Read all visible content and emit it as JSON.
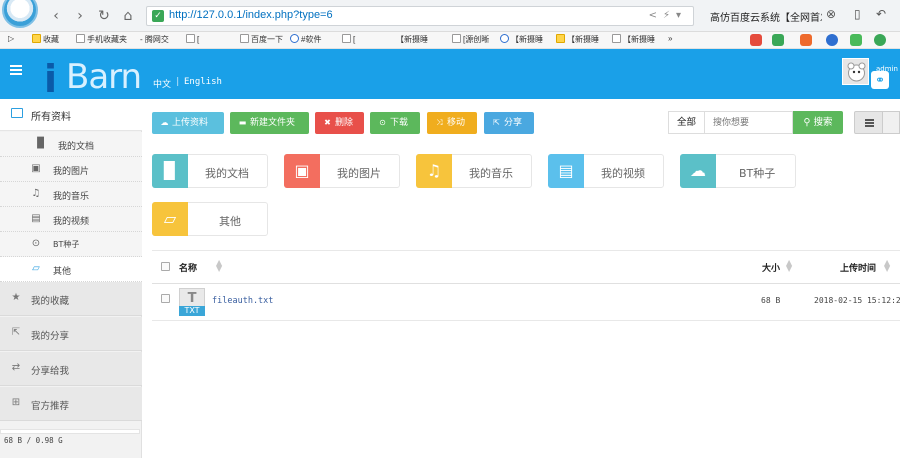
{
  "browser": {
    "url": "http://127.0.0.1/index.php?type=6",
    "tab_title": "高仿百度云系统【全网首发",
    "bookmarks": [
      "收藏",
      "手机收藏夹",
      "- 腾网交",
      "[",
      "百度一下",
      "#软件",
      "[",
      "【新摄睡",
      "[源创晰",
      "【新摄睡",
      "【新摄睡",
      "【新摄睡",
      "»"
    ]
  },
  "header": {
    "logo_i": "i",
    "logo_rest": "Barn",
    "lang_zh": "中文",
    "lang_sep": "|",
    "lang_en": "English",
    "user_name": "admin"
  },
  "sidebar": {
    "all_files": "所有资料",
    "sub_items": [
      {
        "label": "我的文档",
        "icon": "document-icon"
      },
      {
        "label": "我的图片",
        "icon": "image-icon"
      },
      {
        "label": "我的音乐",
        "icon": "music-icon"
      },
      {
        "label": "我的视频",
        "icon": "film-icon"
      },
      {
        "label": "BT种子",
        "icon": "download-circle-icon"
      },
      {
        "label": "其他",
        "icon": "folder-open-icon"
      }
    ],
    "items": [
      {
        "label": "我的收藏",
        "icon": "star-icon"
      },
      {
        "label": "我的分享",
        "icon": "share-icon"
      },
      {
        "label": "分享给我",
        "icon": "retweet-icon"
      },
      {
        "label": "官方推荐",
        "icon": "gift-icon"
      }
    ],
    "quota": "68 B / 0.98 G"
  },
  "toolbar": {
    "upload": "上传资料",
    "new_folder": "新建文件夹",
    "delete": "删除",
    "download": "下载",
    "move": "移动",
    "share": "分享",
    "search_scope": "全部",
    "search_placeholder": "搜你想要",
    "search_button": "搜索"
  },
  "categories": [
    {
      "label": "我的文档",
      "color": "#5bc0c8"
    },
    {
      "label": "我的图片",
      "color": "#f36e5f"
    },
    {
      "label": "我的音乐",
      "color": "#f7c43c"
    },
    {
      "label": "我的视频",
      "color": "#5bc0ec"
    },
    {
      "label": "BT种子",
      "color": "#5bc0c8"
    },
    {
      "label": "其他",
      "color": "#f7c43c"
    }
  ],
  "table": {
    "col_name": "名称",
    "col_size": "大小",
    "col_time": "上传时间",
    "rows": [
      {
        "icon_letter": "T",
        "icon_tag": "TXT",
        "name": "fileauth.txt",
        "size": "68 B",
        "time": "2018-02-15 15:12:2"
      }
    ]
  },
  "colors": {
    "header_blue": "#1aa0e8",
    "btn_upload": "#5bc0de",
    "btn_new_folder": "#5cb85c",
    "btn_delete": "#e8504a",
    "btn_download": "#5cb85c",
    "btn_move": "#f0ad1e",
    "btn_share": "#4aa8e0",
    "btn_search": "#5cb85c"
  }
}
